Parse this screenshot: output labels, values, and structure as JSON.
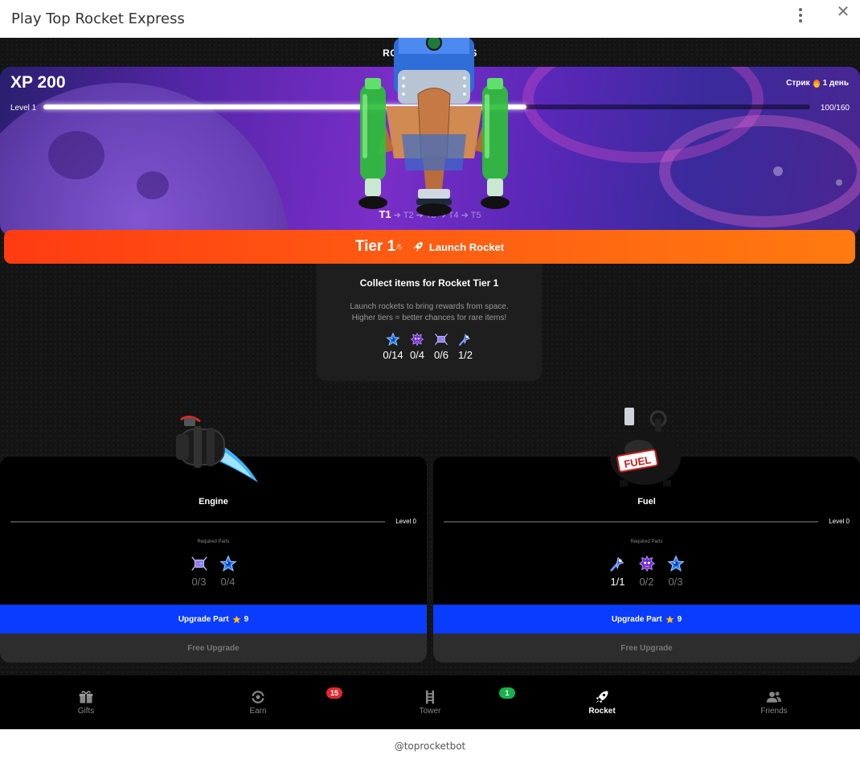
{
  "window": {
    "title": "Play Top Rocket Express"
  },
  "header": {
    "label": "ROCKET EXPRESS"
  },
  "hero": {
    "xp": "XP 200",
    "level": "Level 1",
    "progress_text": "100/160",
    "progress": 0.63,
    "streak_label": "Стрик",
    "streak_value": "1 день",
    "tiers": [
      "T1",
      "T2",
      "T3",
      "T4",
      "T5"
    ],
    "tier_arrow": "➔"
  },
  "launch": {
    "tier": "Tier 1",
    "of": "/5",
    "label": "Launch Rocket"
  },
  "collect": {
    "title": "Collect items for Rocket Tier 1",
    "desc_line1": "Launch rockets to bring rewards from space.",
    "desc_line2": "Higher tiers = better chances for rare items!",
    "items": [
      {
        "icon": "blue-star-item-icon",
        "count": "0/14"
      },
      {
        "icon": "purple-blob-item-icon",
        "count": "0/4"
      },
      {
        "icon": "robot-item-icon",
        "count": "0/6"
      },
      {
        "icon": "comet-item-icon",
        "count": "1/2"
      }
    ]
  },
  "cards": [
    {
      "title": "Engine",
      "level": "Level 0",
      "required_label": "Required Parts",
      "parts": [
        {
          "icon": "robot-item-icon",
          "count": "0/3"
        },
        {
          "icon": "blue-star-item-icon",
          "count": "0/4"
        }
      ],
      "upgrade_label": "Upgrade Part",
      "upgrade_cost": "9",
      "free_label": "Free Upgrade"
    },
    {
      "title": "Fuel",
      "level": "Level 0",
      "required_label": "Required Parts",
      "parts": [
        {
          "icon": "comet-item-icon",
          "count": "1/1"
        },
        {
          "icon": "purple-blob-item-icon",
          "count": "0/2"
        },
        {
          "icon": "blue-star-item-icon",
          "count": "0/3"
        }
      ],
      "upgrade_label": "Upgrade Part",
      "upgrade_cost": "9",
      "free_label": "Free Upgrade",
      "tank_label": "FUEL"
    }
  ],
  "nav": [
    {
      "label": "Gifts",
      "icon": "gift-icon"
    },
    {
      "label": "Earn",
      "icon": "earn-icon",
      "badge": "15"
    },
    {
      "label": "Tower",
      "icon": "tower-icon",
      "badge": "1"
    },
    {
      "label": "Rocket",
      "icon": "rocket-icon",
      "active": true
    },
    {
      "label": "Friends",
      "icon": "friends-icon"
    }
  ],
  "footer": {
    "handle": "@toprocketbot"
  },
  "colors": {
    "launch_start": "#ff3b12",
    "launch_end": "#ff7a10",
    "upgrade": "#0a3cff",
    "badge_red": "#e0282e",
    "badge_green": "#17b34a"
  }
}
